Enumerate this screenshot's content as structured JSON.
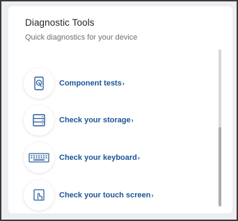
{
  "panel": {
    "title": "Diagnostic Tools",
    "subtitle": "Quick diagnostics for your device"
  },
  "items": [
    {
      "label": "Component tests",
      "icon": "hard-drive-icon"
    },
    {
      "label": "Check your storage",
      "icon": "storage-icon"
    },
    {
      "label": "Check your keyboard",
      "icon": "keyboard-icon"
    },
    {
      "label": "Check your touch screen",
      "icon": "touch-screen-icon"
    }
  ],
  "chevron": "›",
  "colors": {
    "accent": "#1a5596",
    "title": "#222428",
    "subtitle": "#6d7075",
    "icon": "#2c5f9e"
  }
}
